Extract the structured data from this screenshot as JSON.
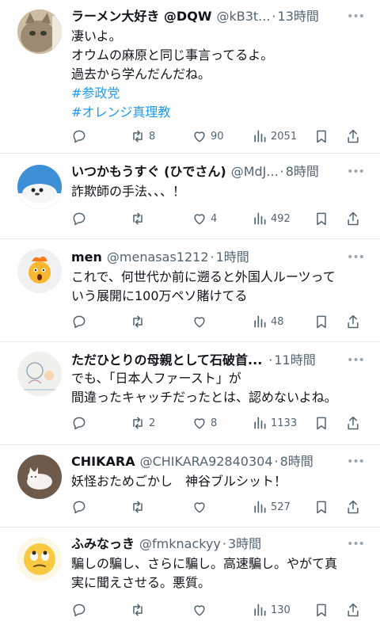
{
  "tweets": [
    {
      "name": "ラーメン大好き @DQW",
      "handle": "@kB3t...",
      "sep": "·",
      "time": "13時間",
      "lines": [
        "凄いよ。",
        "オウムの麻原と同じ事言ってるよ。",
        "過去から学んだんだね。"
      ],
      "hashtags": [
        "#参政党",
        "#オレンジ真理教"
      ],
      "replies": "",
      "retweets": "8",
      "likes": "90",
      "views": "2051",
      "avatar_icon": "cat-avatar"
    },
    {
      "name": "いつかもうすぐ (ひでさん)",
      "handle": "@MdJ...",
      "sep": "·",
      "time": "8時間",
      "lines": [
        "詐欺師の手法、、、！"
      ],
      "hashtags": [],
      "replies": "",
      "retweets": "",
      "likes": "4",
      "views": "492",
      "avatar_icon": "seal-avatar"
    },
    {
      "name": "men",
      "handle": "@menasas1212",
      "sep": "·",
      "time": "1時間",
      "lines": [
        "これで、何世代か前に遡ると外国人ルーツって",
        "いう展開に100万ペソ賭けてる"
      ],
      "hashtags": [],
      "replies": "",
      "retweets": "",
      "likes": "",
      "views": "48",
      "avatar_icon": "shocked-emoji-avatar"
    },
    {
      "name": "ただひとりの母親として石破首...",
      "handle": "",
      "sep": "·",
      "time": "11時間",
      "lines": [
        "でも、「日本人ファースト」が",
        "間違ったキャッチだったとは、認めないよね。"
      ],
      "hashtags": [],
      "replies": "",
      "retweets": "2",
      "likes": "8",
      "views": "1133",
      "avatar_icon": "drawing-avatar"
    },
    {
      "name": "CHIKARA",
      "handle": "@CHIKARA92840304",
      "sep": "·",
      "time": "8時間",
      "lines": [
        "妖怪おためごかし　神谷ブルシット！"
      ],
      "hashtags": [],
      "replies": "",
      "retweets": "",
      "likes": "",
      "views": "527",
      "avatar_icon": "white-cat-avatar"
    },
    {
      "name": "ふみなっき",
      "handle": "@fmknackyy",
      "sep": "·",
      "time": "3時間",
      "lines": [
        "騙しの騙し、さらに騙し。高速騙し。やがて真",
        "実に聞えさせる。悪質。"
      ],
      "hashtags": [],
      "replies": "",
      "retweets": "",
      "likes": "",
      "views": "130",
      "avatar_icon": "rolling-eyes-emoji-avatar"
    }
  ],
  "colors": {
    "text": "#0f1419",
    "secondary": "#536471",
    "hashtag": "#1d9bf0",
    "divider": "#e6ecf0"
  }
}
